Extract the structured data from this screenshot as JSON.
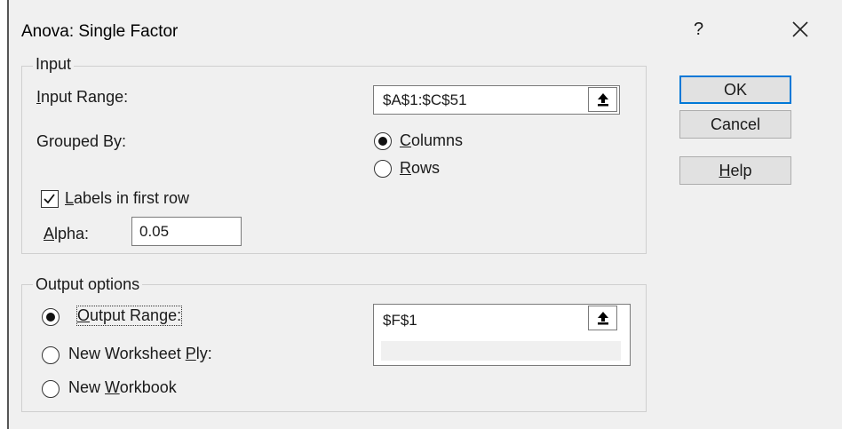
{
  "dialog": {
    "title": "Anova: Single Factor",
    "help_glyph": "?"
  },
  "input_group": {
    "legend": "Input",
    "input_range_label": "Input Range:",
    "input_range_value": "$A$1:$C$51",
    "grouped_by_label": "Grouped By:",
    "grouped_by_options": [
      "Columns",
      "Rows"
    ],
    "grouped_by_selected": "Columns",
    "labels_checkbox_label": "Labels in first row",
    "labels_checked": true,
    "alpha_label": "Alpha:",
    "alpha_value": "0.05"
  },
  "output_group": {
    "legend": "Output options",
    "options": [
      "Output Range:",
      "New Worksheet Ply:",
      "New Workbook"
    ],
    "selected": "Output Range:",
    "output_range_value": "$F$1",
    "worksheet_ply_value": ""
  },
  "buttons": {
    "ok": "OK",
    "cancel": "Cancel",
    "help": "Help"
  },
  "icons": {
    "range_select": "collapse-dialog-arrow-icon",
    "close": "close-icon"
  }
}
